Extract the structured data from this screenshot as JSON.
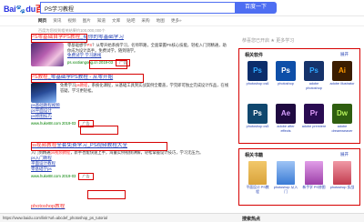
{
  "header": {
    "logo_prefix": "Bai",
    "logo_mid": "du",
    "logo_suffix": "百度",
    "query": "PS学习教程",
    "search_button": "百度一下"
  },
  "tabs": [
    "网页",
    "资讯",
    "视频",
    "图片",
    "知道",
    "文库",
    "贴吧",
    "采购",
    "地图",
    "更多»"
  ],
  "result_count": "百度为您找到相关结果约100,000,000个",
  "results": [
    {
      "title_pre": "",
      "title_em": "PS零基础自学PS教程",
      "title_post": "_有你的零基础学习",
      "desc_pre": "零基础想学",
      "desc_em": "PS",
      "desc_post": "？从零开始系统学习，名师带路，全面掌握PS核心技能，轻松入门到精通，助你成为设计高手。免费试学，随到随学。",
      "sublink": "免费试学 学习路线",
      "url": "ps.xxxtiangong.cn  2019-03",
      "ad": "广告"
    },
    {
      "title_pre": "",
      "title_em": "PS教程",
      "title_post": "_零基础学PS教程 - 从零开始",
      "desc_pre": "免费学习",
      "desc_em": "ps教程",
      "desc_post": "，系统化课程，从基础工具到实战案例全覆盖，学完即可独立完成设计作品，在线答疑，学习更轻松。",
      "links": [
        "ps基础教程视频",
        "ps平面设计",
        "ps修图技巧"
      ],
      "url": "www.huke88.com  2019-03",
      "ad": "广告"
    },
    {
      "title_pre": "",
      "title_em": "ps视频教程",
      "title_post": "全套免费学习_PS视频教程大全",
      "desc_pre": "入门到精通",
      "desc_em": "ps视频教程",
      "desc_post": "，新手也能快速上手，海量实例视频讲解，轻松掌握设计技巧，学习无压力。",
      "links": [
        "ps入门教程",
        "平面设计教程",
        "零基础学ps"
      ],
      "url": "www.huke88.com  2019-03",
      "ad": "广告"
    },
    {
      "title_pre": "",
      "title_em": "photoshop教程",
      "title_post": "",
      "desc_pre": "",
      "desc_em": "",
      "desc_post": "",
      "url": "",
      "ad": ""
    }
  ],
  "status_url": "https://www.baidu.com/link?url=abcdef_photoshop_ps_tutorial",
  "sidebar": {
    "notice": "恭喜您已开启 ★ 更多学习",
    "software": {
      "title": "相关软件",
      "more": "展开",
      "items": [
        {
          "label": "photoshop cs6",
          "abbr": "Ps",
          "color": "#0b2d6b",
          "text_color": "#31a8ff"
        },
        {
          "label": "photoshop",
          "abbr": "Ps",
          "color": "#0e4fa8",
          "text_color": "#ffffff"
        },
        {
          "label": "adobe photoshop",
          "abbr": "Ps",
          "color": "#16336b",
          "text_color": "#31a8ff"
        },
        {
          "label": "adobe illustrator",
          "abbr": "Ai",
          "color": "#3b1d00",
          "text_color": "#ff9a00"
        },
        {
          "label": "photoshop cs5",
          "abbr": "Ps",
          "color": "#10476e",
          "text_color": "#ffffff"
        },
        {
          "label": "adobe after effects",
          "abbr": "Ae",
          "color": "#1f0a40",
          "text_color": "#d8a1ff"
        },
        {
          "label": "adobe premiere",
          "abbr": "Pr",
          "color": "#2a0c52",
          "text_color": "#e4a0ff"
        },
        {
          "label": "adobe dreamweaver",
          "abbr": "Dw",
          "color": "#2f5e10",
          "text_color": "#b6f15b"
        }
      ]
    },
    "books": {
      "title": "相关书籍",
      "more": "展开",
      "items": [
        {
          "label": "平面设计 PS教程",
          "color": "#d9a33b"
        },
        {
          "label": "photoshop 从入门",
          "color": "#3a7bd5"
        },
        {
          "label": "新手学 PS修图",
          "color": "#9c3fa8"
        },
        {
          "label": "photoshop 实战",
          "color": "#c23b4e"
        }
      ]
    },
    "hot_title": "搜索热点"
  }
}
